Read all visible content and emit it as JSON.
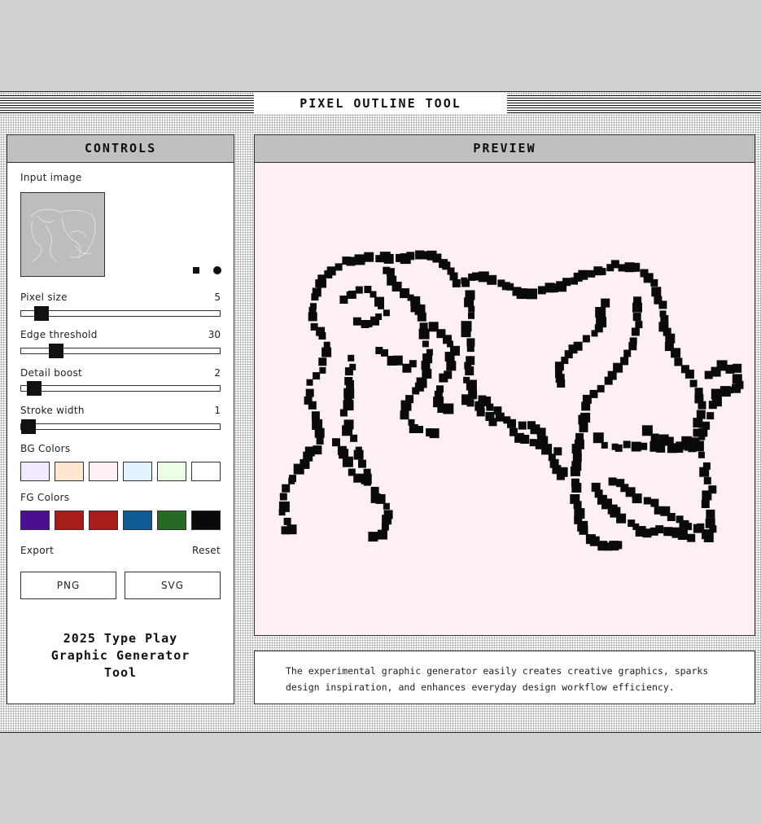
{
  "app": {
    "title": "PIXEL OUTLINE TOOL"
  },
  "controls": {
    "heading": "CONTROLS",
    "input_image_label": "Input image",
    "sliders": [
      {
        "label": "Pixel size",
        "value": "5",
        "fraction": 0.07
      },
      {
        "label": "Edge threshold",
        "value": "30",
        "fraction": 0.15
      },
      {
        "label": "Detail boost",
        "value": "2",
        "fraction": 0.03
      },
      {
        "label": "Stroke width",
        "value": "1",
        "fraction": 0.0
      }
    ],
    "bg_colors_label": "BG Colors",
    "bg_colors": [
      "#f3eaff",
      "#fde6d2",
      "#fdf0f2",
      "#e2f3fd",
      "#eefde6",
      "#ffffff"
    ],
    "fg_colors_label": "FG Colors",
    "fg_colors": [
      "#4b0f8f",
      "#a81c1c",
      "#a81c1c",
      "#0f5a94",
      "#266a26",
      "#0a0a0a"
    ],
    "export_label": "Export",
    "reset_label": "Reset",
    "png_label": "PNG",
    "svg_label": "SVG",
    "tagline": [
      "2025 Type Play",
      "Graphic Generator",
      "Tool"
    ]
  },
  "preview": {
    "heading": "PREVIEW",
    "canvas_bg": "#fdf0f2",
    "stroke_color": "#0a0a0a"
  },
  "description": {
    "lines": [
      "The experimental graphic generator easily creates creative graphics, sparks",
      "design inspiration, and enhances everyday design workflow efficiency."
    ]
  }
}
